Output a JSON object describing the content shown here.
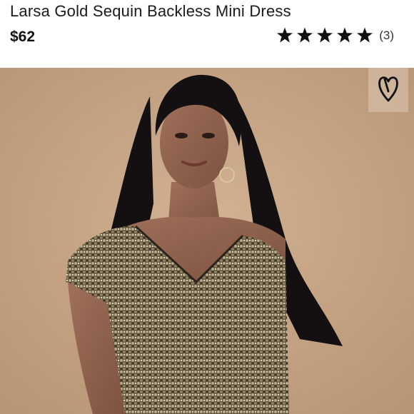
{
  "product": {
    "title": "Larsa Gold Sequin Backless Mini Dress",
    "price": "$62",
    "rating": 5,
    "rating_max": 5,
    "review_count": "(3)"
  },
  "icons": {
    "star": "star-icon",
    "favorite": "heart-icon"
  },
  "colors": {
    "star": "#111111",
    "backdrop": "#c8a787",
    "sequin": "#8a7a5a"
  }
}
